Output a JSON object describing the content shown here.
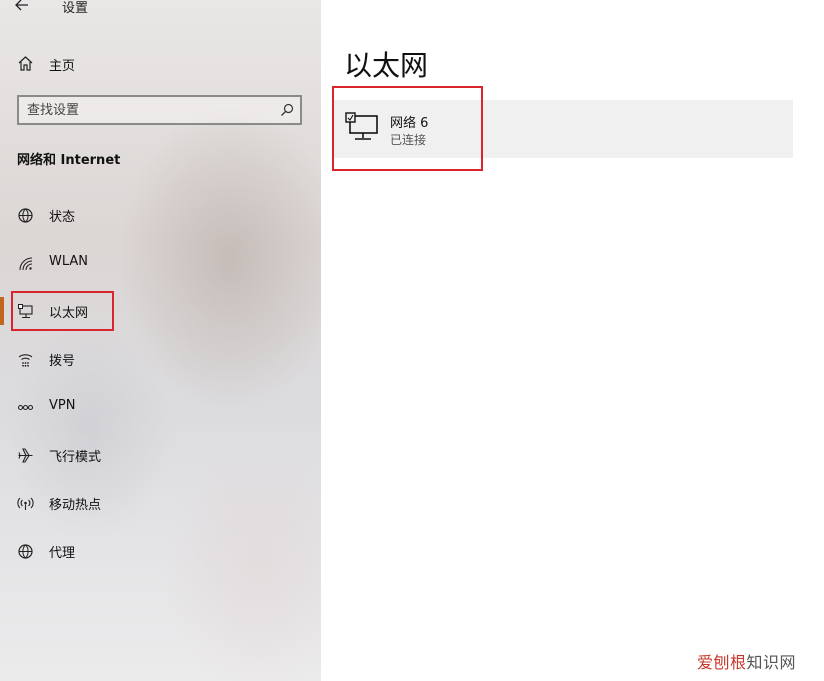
{
  "window": {
    "title": "设置"
  },
  "sidebar": {
    "home_label": "主页",
    "search": {
      "placeholder": "查找设置"
    },
    "section_title": "网络和 Internet",
    "items": [
      {
        "label": "状态",
        "icon": "status-globe-icon"
      },
      {
        "label": "WLAN",
        "icon": "wifi-icon"
      },
      {
        "label": "以太网",
        "icon": "ethernet-icon",
        "selected": true
      },
      {
        "label": "拨号",
        "icon": "dialup-icon"
      },
      {
        "label": "VPN",
        "icon": "vpn-icon"
      },
      {
        "label": "飞行模式",
        "icon": "airplane-icon"
      },
      {
        "label": "移动热点",
        "icon": "hotspot-icon"
      },
      {
        "label": "代理",
        "icon": "proxy-globe-icon"
      }
    ]
  },
  "main": {
    "title": "以太网",
    "network": {
      "name": "网络  6",
      "status": "已连接"
    }
  },
  "watermark": {
    "part1": "爱刨根",
    "part2": "知识网"
  },
  "colors": {
    "accent": "#c2651f",
    "highlight_box": "#d9252b"
  }
}
